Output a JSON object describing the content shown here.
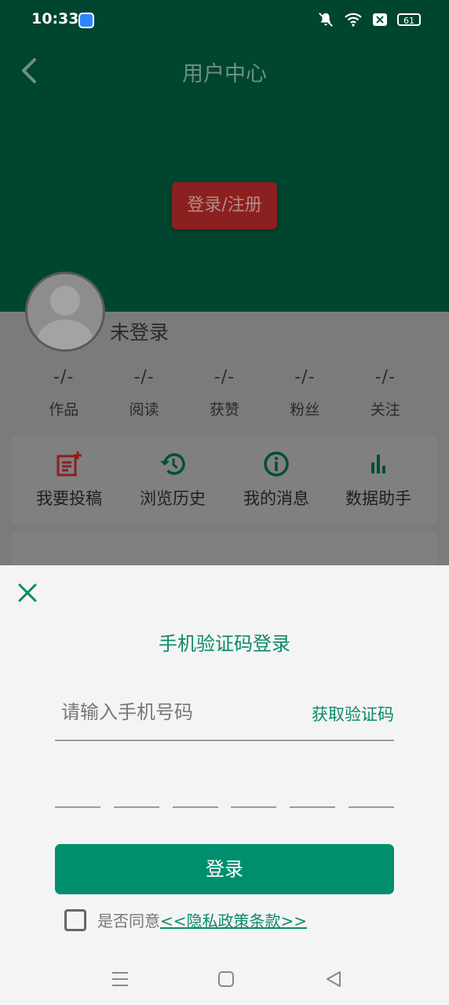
{
  "status_bar": {
    "time": "10:33",
    "battery": "61"
  },
  "header": {
    "title": "用户中心",
    "login_register_label": "登录/注册"
  },
  "profile": {
    "username": "未登录",
    "stats": [
      {
        "value": "-/-",
        "label": "作品"
      },
      {
        "value": "-/-",
        "label": "阅读"
      },
      {
        "value": "-/-",
        "label": "获赞"
      },
      {
        "value": "-/-",
        "label": "粉丝"
      },
      {
        "value": "-/-",
        "label": "关注"
      }
    ]
  },
  "quick_actions": [
    {
      "label": "我要投稿",
      "icon": "post-add-icon",
      "color": "#8b2020"
    },
    {
      "label": "浏览历史",
      "icon": "history-icon",
      "color": "#004d3a"
    },
    {
      "label": "我的消息",
      "icon": "info-icon",
      "color": "#004d3a"
    },
    {
      "label": "数据助手",
      "icon": "bar-chart-icon",
      "color": "#004d3a"
    }
  ],
  "login_sheet": {
    "title": "手机验证码登录",
    "phone_placeholder": "请输入手机号码",
    "get_code_label": "获取验证码",
    "login_label": "登录",
    "agree_prefix": "是否同意",
    "policy_link": "<<隐私政策条款>>"
  },
  "colors": {
    "primary": "#008f6e",
    "header": "#00573f",
    "accent_red": "#8b2020"
  }
}
